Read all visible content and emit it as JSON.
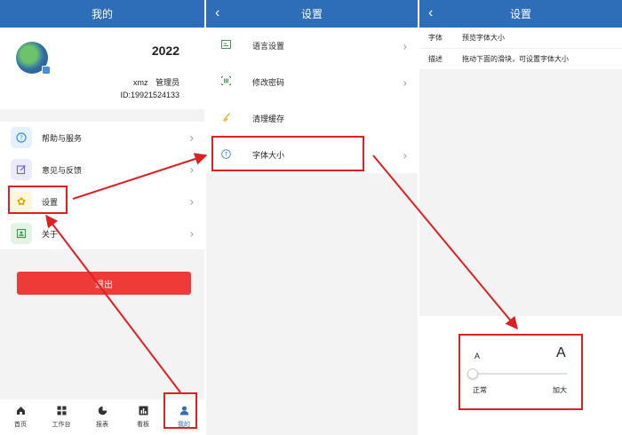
{
  "panel1": {
    "header_title": "我的",
    "profile": {
      "year": "2022",
      "username": "xmz",
      "role": "管理员",
      "id_text": "ID:19921524133"
    },
    "menu": [
      {
        "label": "帮助与服务",
        "icon": "question-icon",
        "color": "#e3f1fb"
      },
      {
        "label": "意见与反馈",
        "icon": "edit-icon",
        "color": "#ecebfb"
      },
      {
        "label": "设置",
        "icon": "gear-icon",
        "color": "#fdf6dc"
      },
      {
        "label": "关于",
        "icon": "info-card-icon",
        "color": "#e4f4e4"
      }
    ],
    "logout_label": "退出",
    "tabs": [
      {
        "label": "首页",
        "icon": "home-icon"
      },
      {
        "label": "工作台",
        "icon": "grid-icon"
      },
      {
        "label": "报表",
        "icon": "pie-icon"
      },
      {
        "label": "看板",
        "icon": "board-icon"
      },
      {
        "label": "我的",
        "icon": "user-icon",
        "active": true
      }
    ]
  },
  "panel2": {
    "header_title": "设置",
    "back_glyph": "‹",
    "items": [
      {
        "label": "语言设置",
        "icon": "language-icon"
      },
      {
        "label": "修改密码",
        "icon": "barcode-icon"
      },
      {
        "label": "清理缓存",
        "icon": "broom-icon"
      },
      {
        "label": "字体大小",
        "icon": "font-size-icon"
      }
    ]
  },
  "panel3": {
    "header_title": "设置",
    "back_glyph": "‹",
    "rows": [
      {
        "key": "字体",
        "value": "预览字体大小"
      },
      {
        "key": "描述",
        "value": "拖动下面的滑块，可设置字体大小"
      }
    ],
    "slider": {
      "small_glyph": "A",
      "big_glyph": "A",
      "left_label": "正常",
      "right_label": "加大",
      "value_fraction": 0.0
    }
  },
  "colors": {
    "accent": "#2e6db8",
    "logout": "#ee3b38",
    "annotation": "#e02020"
  }
}
